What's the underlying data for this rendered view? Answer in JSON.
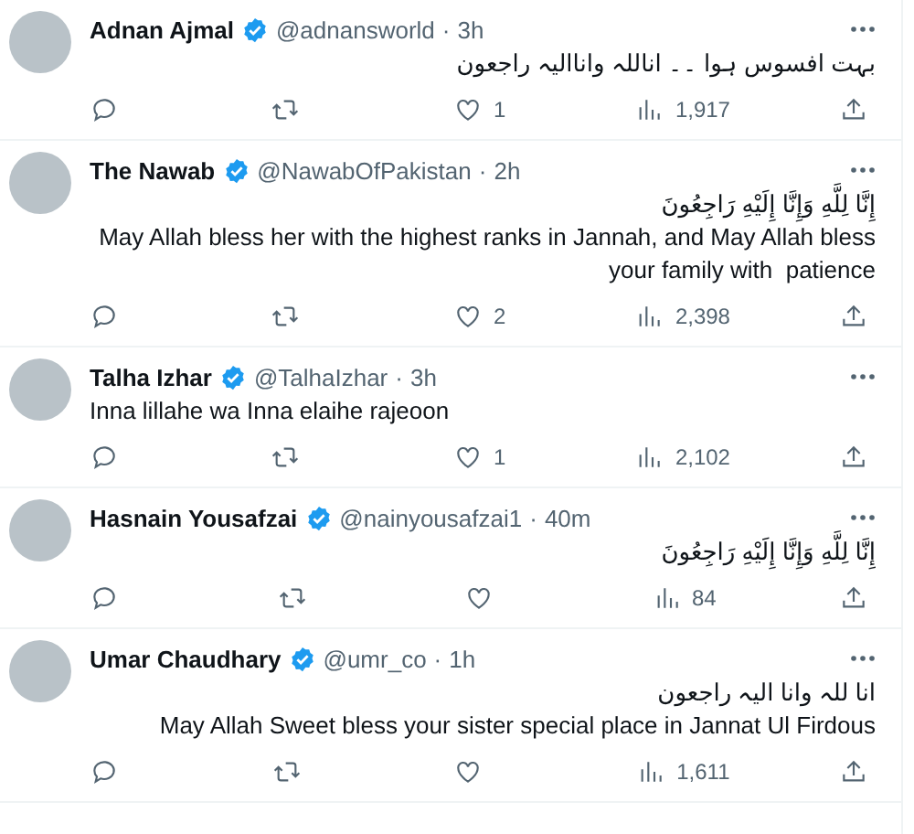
{
  "replies": [
    {
      "name": "Adnan Ajmal",
      "verified": true,
      "handle": "@adnansworld",
      "dot": "·",
      "time": "3h",
      "lines": [
        "بہت افسوس ہوا ۔۔ اناللہ واناالیہ راجعون"
      ],
      "rtl": true,
      "likes": "1",
      "views": "1,917"
    },
    {
      "name": "The Nawab",
      "verified": true,
      "handle": "@NawabOfPakistan",
      "dot": "·",
      "time": "2h",
      "lines": [
        "إِنَّا لِلَّهِ وَإِنَّا إِلَيْهِ رَاجِعُونَ",
        "May Allah bless her with the highest ranks in Jannah, and May Allah bless",
        "your family with  patience"
      ],
      "rtl": true,
      "likes": "2",
      "views": "2,398"
    },
    {
      "name": "Talha Izhar",
      "verified": true,
      "handle": "@TalhaIzhar",
      "dot": "·",
      "time": "3h",
      "lines": [
        "Inna lillahe wa Inna elaihe rajeoon"
      ],
      "rtl": false,
      "likes": "1",
      "views": "2,102"
    },
    {
      "name": "Hasnain Yousafzai",
      "verified": true,
      "handle": "@nainyousafzai1",
      "dot": "·",
      "time": "40m",
      "lines": [
        "إِنَّا لِلَّهِ وَإِنَّا إِلَيْهِ رَاجِعُونَ"
      ],
      "rtl": true,
      "views": "84"
    },
    {
      "name": "Umar Chaudhary",
      "verified": true,
      "handle": "@umr_co",
      "dot": "·",
      "time": "1h",
      "lines": [
        "انا للہ وانا الیہ راجعون",
        "May Allah Sweet bless your sister special place in Jannat Ul Firdous"
      ],
      "rtl": true,
      "views": "1,611"
    }
  ]
}
